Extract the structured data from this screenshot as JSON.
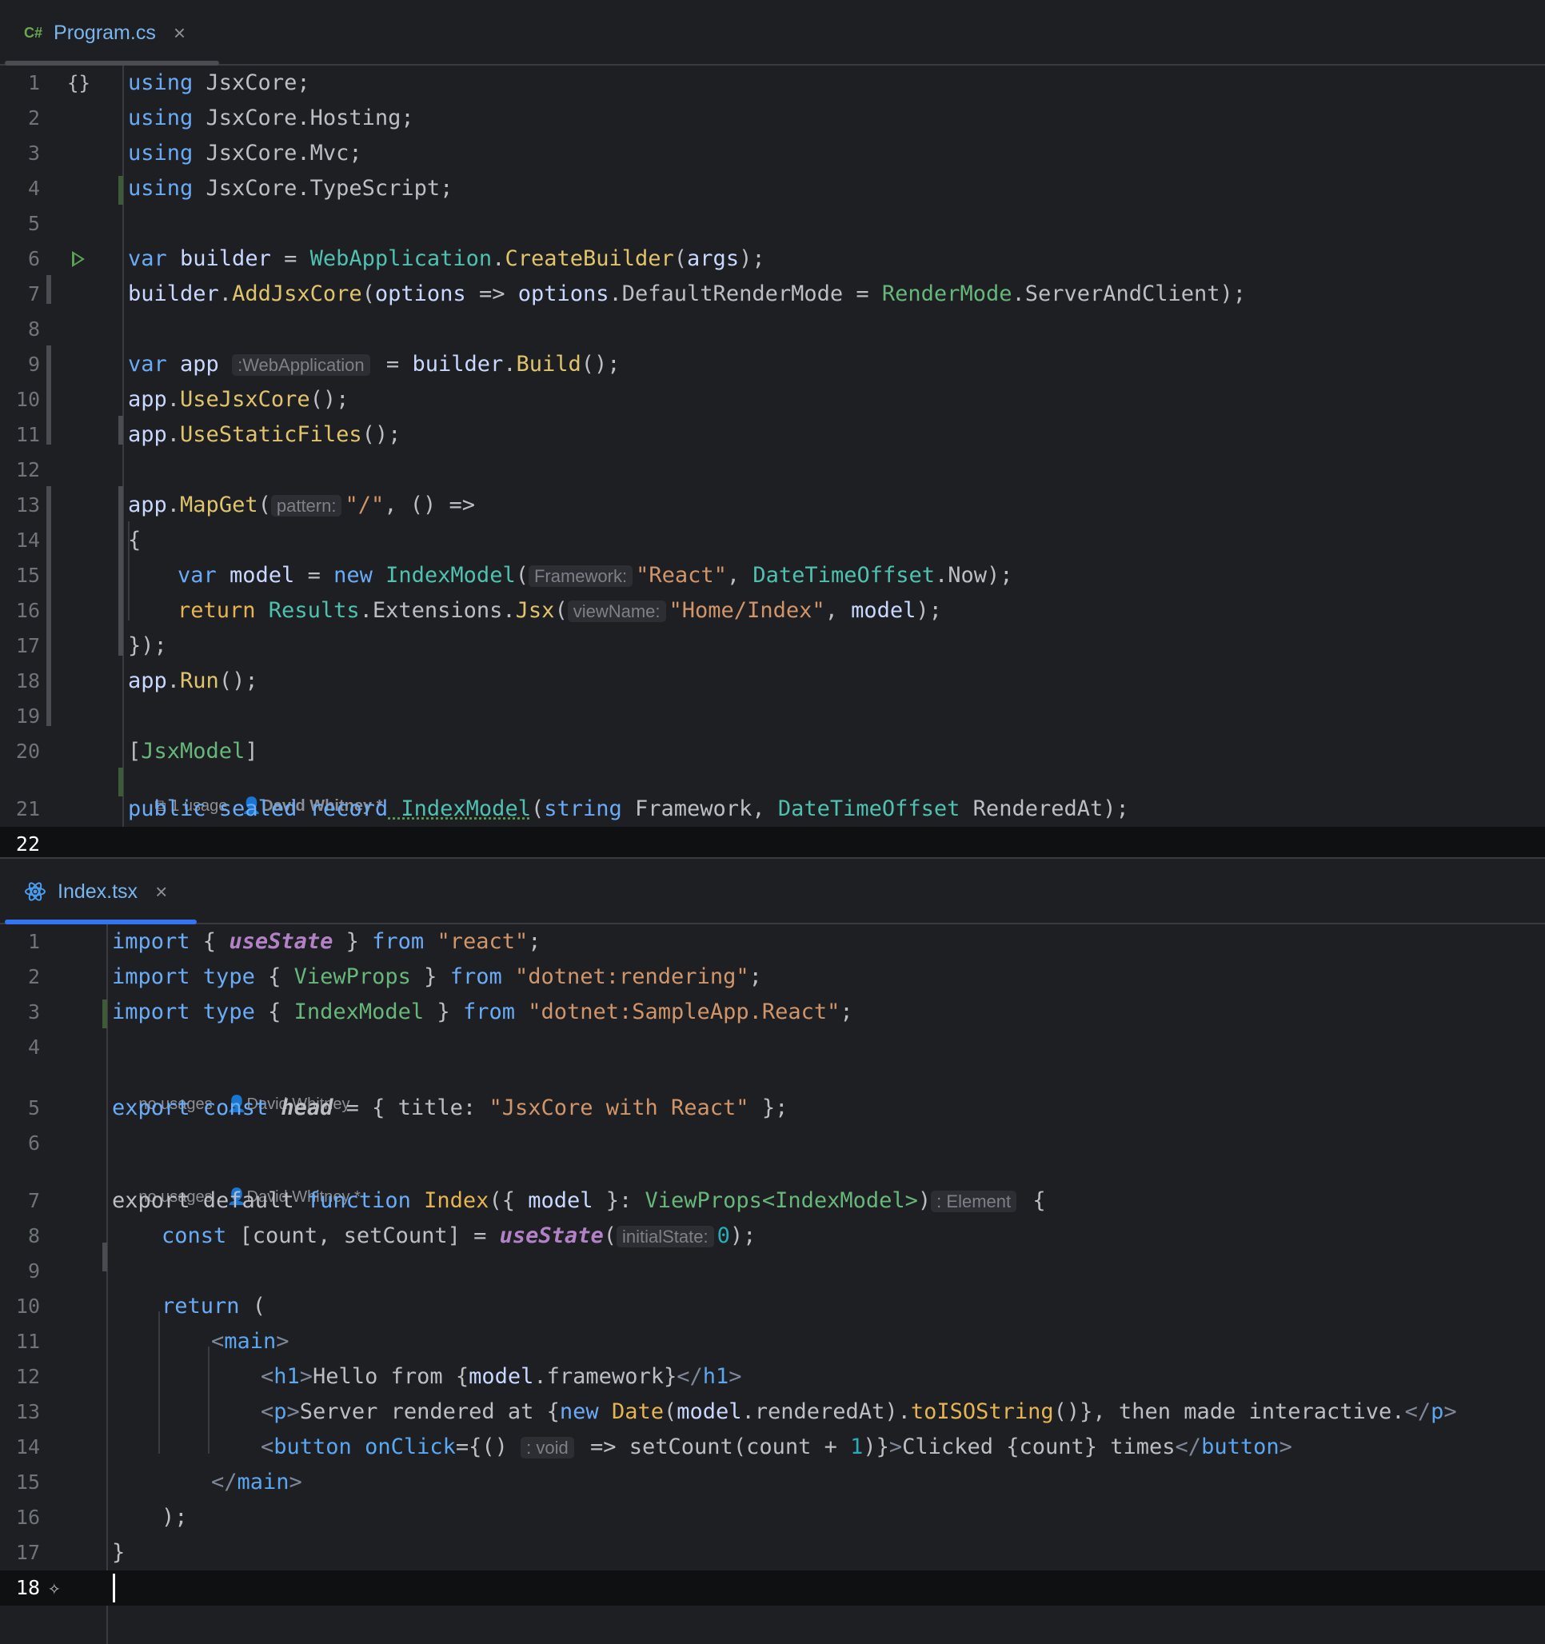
{
  "tabs": [
    {
      "icon": "C#",
      "label": "Program.cs",
      "close": "×"
    },
    {
      "icon": "react-icon",
      "label": "Index.tsx",
      "close": "×"
    }
  ],
  "colors": {
    "tab_underline_1": "#4a4c52",
    "tab_underline_2": "#3574f0",
    "background": "#1e1f22"
  },
  "program": {
    "line_numbers": [
      "1",
      "2",
      "3",
      "4",
      "5",
      "6",
      "7",
      "8",
      "9",
      "10",
      "11",
      "12",
      "13",
      "14",
      "15",
      "16",
      "17",
      "18",
      "19",
      "20",
      "21",
      "22"
    ],
    "code": {
      "l1_kw": "using",
      "l1_rest": " JsxCore;",
      "l2_kw": "using",
      "l2_rest": " JsxCore.Hosting;",
      "l3_kw": "using",
      "l3_rest": " JsxCore.Mvc;",
      "l4_kw": "using",
      "l4_rest": " JsxCore.TypeScript;",
      "l6_var": "var",
      "l6_builder": " builder",
      "l6_eq": " = ",
      "l6_type": "WebApplication",
      "l6_dot": ".",
      "l6_fn": "CreateBuilder",
      "l6_p1": "(",
      "l6_args": "args",
      "l6_p2": ");",
      "l7_builder": "builder",
      "l7_dot": ".",
      "l7_fn": "AddJsxCore",
      "l7_p1": "(",
      "l7_opt": "options",
      "l7_arrow": " => ",
      "l7_opt2": "options",
      "l7_prop": ".DefaultRenderMode",
      "l7_eq": " = ",
      "l7_type": "RenderMode",
      "l7_rest": ".ServerAndClient);",
      "l9_var": "var",
      "l9_app": " app",
      "l9_hint": ":WebApplication",
      "l9_eq": " = ",
      "l9_builder": "builder",
      "l9_dot": ".",
      "l9_fn": "Build",
      "l9_end": "();",
      "l10_app": "app",
      "l10_dot": ".",
      "l10_fn": "UseJsxCore",
      "l10_end": "();",
      "l11_app": "app",
      "l11_dot": ".",
      "l11_fn": "UseStaticFiles",
      "l11_end": "();",
      "l13_app": "app",
      "l13_dot": ".",
      "l13_fn": "MapGet",
      "l13_p": "(",
      "l13_hint": "pattern:",
      "l13_str": "\"/\"",
      "l13_rest": ", () =>",
      "l14": "{",
      "l15_var": "var",
      "l15_model": " model",
      "l15_eq": " = ",
      "l15_new": "new",
      "l15_type": " IndexModel",
      "l15_p": "(",
      "l15_hint": "Framework:",
      "l15_str": "\"React\"",
      "l15_comma": ", ",
      "l15_type2": "DateTimeOffset",
      "l15_rest": ".Now);",
      "l16_ret": "return",
      "l16_type": " Results",
      "l16_mid": ".Extensions.",
      "l16_fn": "Jsx",
      "l16_p": "(",
      "l16_hint": "viewName:",
      "l16_str": "\"Home/Index\"",
      "l16_comma": ", ",
      "l16_model": "model",
      "l16_end": ");",
      "l17": "});",
      "l18_app": "app",
      "l18_dot": ".",
      "l18_fn": "Run",
      "l18_end": "();",
      "l20_b1": "[",
      "l20_attr": "JsxModel",
      "l20_b2": "]",
      "lens_usage": "1 usage",
      "lens_author": "David Whitney *",
      "l21_pub": "public",
      "l21_sealed": " sealed",
      "l21_record": " record",
      "l21_name": " IndexModel",
      "l21_p": "(",
      "l21_string": "string",
      "l21_fw": " Framework, ",
      "l21_type": "DateTimeOffset",
      "l21_rest": " RenderedAt);"
    }
  },
  "index": {
    "line_numbers": [
      "1",
      "2",
      "3",
      "4",
      "5",
      "6",
      "7",
      "8",
      "9",
      "10",
      "11",
      "12",
      "13",
      "14",
      "15",
      "16",
      "17",
      "18"
    ],
    "code": {
      "l1_import": "import",
      "l1_b1": " { ",
      "l1_use": "useState",
      "l1_b2": " } ",
      "l1_from": "from",
      "l1_str": " \"react\"",
      "l1_end": ";",
      "l2_import": "import",
      "l2_type": " type",
      "l2_b1": " { ",
      "l2_name": "ViewProps",
      "l2_b2": " } ",
      "l2_from": "from",
      "l2_str": " \"dotnet:rendering\"",
      "l2_end": ";",
      "l3_import": "import",
      "l3_type": " type",
      "l3_b1": " { ",
      "l3_name": "IndexModel",
      "l3_b2": " } ",
      "l3_from": "from",
      "l3_str": " \"dotnet:SampleApp.React\"",
      "l3_end": ";",
      "lens1_usage": "no usages",
      "lens1_author": "David Whitney",
      "l5_export": "export",
      "l5_const": " const",
      "l5_head": " head",
      "l5_rest": " = { title: ",
      "l5_str": "\"JsxCore with React\"",
      "l5_end": " };",
      "lens2_usage": "no usages",
      "lens2_author": "David Whitney *",
      "l7_export": "export default ",
      "l7_function": "function",
      "l7_name": " Index",
      "l7_b1": "({ ",
      "l7_model": "model",
      "l7_b2": " }: ",
      "l7_type": "ViewProps<IndexModel>",
      "l7_p": ")",
      "l7_hint": ": Element",
      "l7_brace": " {",
      "l8_const": "const",
      "l8_rest": " [count, setCount] = ",
      "l8_use": "useState",
      "l8_p": "(",
      "l8_hint": "initialState:",
      "l8_num": "0",
      "l8_end": ");",
      "l10_ret": "return",
      "l10_rest": " (",
      "l11_lt": "<",
      "l11_tag": "main",
      "l11_gt": ">",
      "l12_lt": "<",
      "l12_tag": "h1",
      "l12_gt": ">",
      "l12_text": "Hello from {",
      "l12_model": "model",
      "l12_prop": ".framework}",
      "l12_close_lt": "</",
      "l12_close_tag": "h1",
      "l12_close_gt": ">",
      "l13_lt": "<",
      "l13_tag": "p",
      "l13_gt": ">",
      "l13_text": "Server rendered at {",
      "l13_new": "new",
      "l13_date": " Date",
      "l13_p1": "(",
      "l13_model": "model",
      "l13_prop": ".renderedAt).",
      "l13_fn": "toISOString",
      "l13_rest": "()}, then made interactive.",
      "l13_close_lt": "</",
      "l13_close_tag": "p",
      "l13_close_gt": ">",
      "l14_lt": "<",
      "l14_tag": "button",
      "l14_attr": " onClick",
      "l14_eq": "={()",
      "l14_hint": ": void",
      "l14_arrow": " => setCount(count + ",
      "l14_num": "1",
      "l14_rest": ")}",
      "l14_gt": ">",
      "l14_text": "Clicked {count} times",
      "l14_close_lt": "</",
      "l14_close_tag": "button",
      "l14_close_gt": ">",
      "l15_lt": "</",
      "l15_tag": "main",
      "l15_gt": ">",
      "l16": ");",
      "l17": "}"
    }
  }
}
